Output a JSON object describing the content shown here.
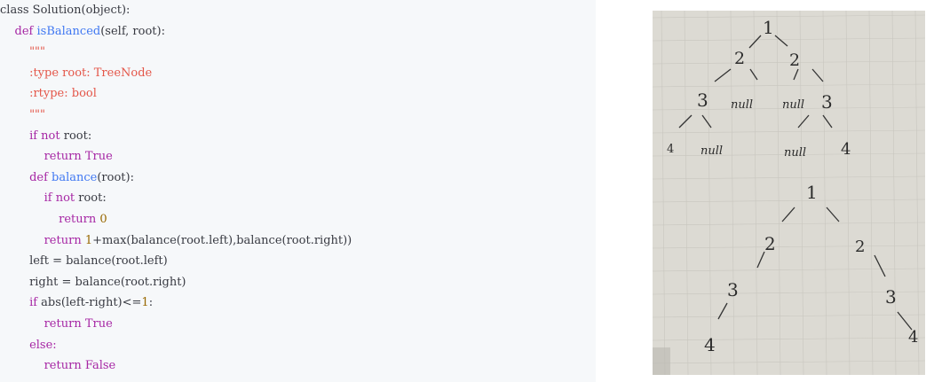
{
  "code": {
    "lines": [
      {
        "indent": "",
        "parts": [
          {
            "t": "class Solution(object):",
            "c": "plain"
          }
        ]
      },
      {
        "indent": "    ",
        "parts": [
          {
            "t": "def ",
            "c": "kw"
          },
          {
            "t": "isBalanced",
            "c": "fn"
          },
          {
            "t": "(self, root):",
            "c": "plain"
          }
        ]
      },
      {
        "indent": "        ",
        "parts": [
          {
            "t": "\"\"\"",
            "c": "str"
          }
        ]
      },
      {
        "indent": "        ",
        "parts": [
          {
            "t": ":type root: TreeNode",
            "c": "str"
          }
        ]
      },
      {
        "indent": "        ",
        "parts": [
          {
            "t": ":rtype: bool",
            "c": "str"
          }
        ]
      },
      {
        "indent": "        ",
        "parts": [
          {
            "t": "\"\"\"",
            "c": "str"
          }
        ]
      },
      {
        "indent": "        ",
        "parts": [
          {
            "t": "if not ",
            "c": "kw"
          },
          {
            "t": "root:",
            "c": "plain"
          }
        ]
      },
      {
        "indent": "            ",
        "parts": [
          {
            "t": "return True",
            "c": "kw"
          }
        ]
      },
      {
        "indent": "        ",
        "parts": [
          {
            "t": "def ",
            "c": "kw"
          },
          {
            "t": "balance",
            "c": "fn"
          },
          {
            "t": "(root):",
            "c": "plain"
          }
        ]
      },
      {
        "indent": "            ",
        "parts": [
          {
            "t": "if not ",
            "c": "kw"
          },
          {
            "t": "root:",
            "c": "plain"
          }
        ]
      },
      {
        "indent": "                ",
        "parts": [
          {
            "t": "return ",
            "c": "kw"
          },
          {
            "t": "0",
            "c": "num"
          }
        ]
      },
      {
        "indent": "            ",
        "parts": [
          {
            "t": "return ",
            "c": "kw"
          },
          {
            "t": "1",
            "c": "num"
          },
          {
            "t": "+max(balance(root.left),balance(root.right))",
            "c": "plain"
          }
        ]
      },
      {
        "indent": "        ",
        "parts": [
          {
            "t": "left = balance(root.left)",
            "c": "plain"
          }
        ]
      },
      {
        "indent": "        ",
        "parts": [
          {
            "t": "right = balance(root.right)",
            "c": "plain"
          }
        ]
      },
      {
        "indent": "        ",
        "parts": [
          {
            "t": "if ",
            "c": "kw"
          },
          {
            "t": "abs(left-right)<=",
            "c": "plain"
          },
          {
            "t": "1",
            "c": "num"
          },
          {
            "t": ":",
            "c": "plain"
          }
        ]
      },
      {
        "indent": "            ",
        "parts": [
          {
            "t": "return True",
            "c": "kw"
          }
        ]
      },
      {
        "indent": "        ",
        "parts": [
          {
            "t": "else:",
            "c": "kw"
          }
        ]
      },
      {
        "indent": "            ",
        "parts": [
          {
            "t": "return False",
            "c": "kw"
          }
        ]
      }
    ]
  },
  "photo": {
    "labels": [
      "1",
      "2",
      "2",
      "3",
      "null",
      "null",
      "3",
      "4",
      "null",
      "null",
      "4",
      "1",
      "2",
      "2",
      "3",
      "3",
      "4",
      "4"
    ]
  },
  "colors": {
    "code_background": "#f6f8fa",
    "keyword": "#a626a4",
    "function": "#4078f2",
    "string": "#e45649",
    "number": "#986801",
    "paper": "#dcdad3"
  }
}
